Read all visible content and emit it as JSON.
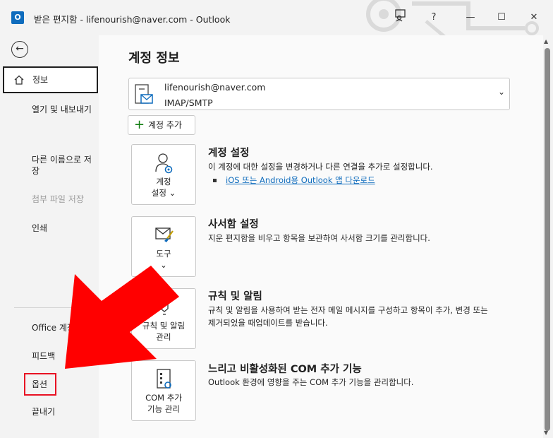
{
  "window": {
    "app_logo": "O",
    "title": "받은 편지함 - lifenourish@naver.com  -  Outlook",
    "icons": [
      "outlook-logo-icon",
      "coauthor-icon",
      "help-icon",
      "minimize-icon",
      "maximize-icon",
      "close-icon"
    ],
    "help": "?",
    "minimize": "—",
    "maximize": "☐",
    "close": "✕"
  },
  "sidebar": {
    "back_glyph": "←",
    "items": [
      {
        "label": "정보",
        "selected": true
      },
      {
        "label": "열기 및 내보내기"
      },
      {
        "label": "다른 이름으로 저장"
      },
      {
        "label": "첨부 파일 저장",
        "disabled": true
      },
      {
        "label": "인쇄"
      },
      {
        "label": "Office 계정"
      },
      {
        "label": "피드백"
      },
      {
        "label": "옵션",
        "highlighted": true
      },
      {
        "label": "끝내기"
      }
    ]
  },
  "main": {
    "heading": "계정 정보",
    "account": {
      "email": "lifenourish@naver.com",
      "type": "IMAP/SMTP",
      "chevron": "⌄"
    },
    "add_account": {
      "plus": "+",
      "label": "계정 추가"
    },
    "sections": [
      {
        "card_line1": "계정",
        "card_line2": "설정 ⌄",
        "title": "계정 설정",
        "desc": "이 계정에 대한 설정을 변경하거나 다른 연결을 추가로 설정합니다.",
        "link": "iOS 또는 Android용 Outlook 앱 다운로드"
      },
      {
        "card_line1": "도구",
        "card_line2": "⌄",
        "title": "사서함 설정",
        "desc": "지운 편지함을 비우고 항목을 보관하여 사서함 크기를 관리합니다."
      },
      {
        "card_line1": "규칙 및 알림",
        "card_line2": "관리",
        "title": "규칙 및 알림",
        "desc": "규칙 및 알림을 사용하여 받는 전자 메일 메시지를 구성하고 항목이 추가, 변경 또는 제거되었을 때업데이트를 받습니다."
      },
      {
        "card_line1": "COM 추가",
        "card_line2": "기능 관리",
        "title": "느리고 비활성화된 COM 추가 기능",
        "desc": "Outlook 환경에 영향을 주는 COM 추가 기능을 관리합니다."
      }
    ]
  },
  "annotation": {
    "arrow_color": "#ff0000",
    "box_color": "#e81123"
  },
  "colors": {
    "accent": "#0f6cbd",
    "green": "#107c10"
  }
}
